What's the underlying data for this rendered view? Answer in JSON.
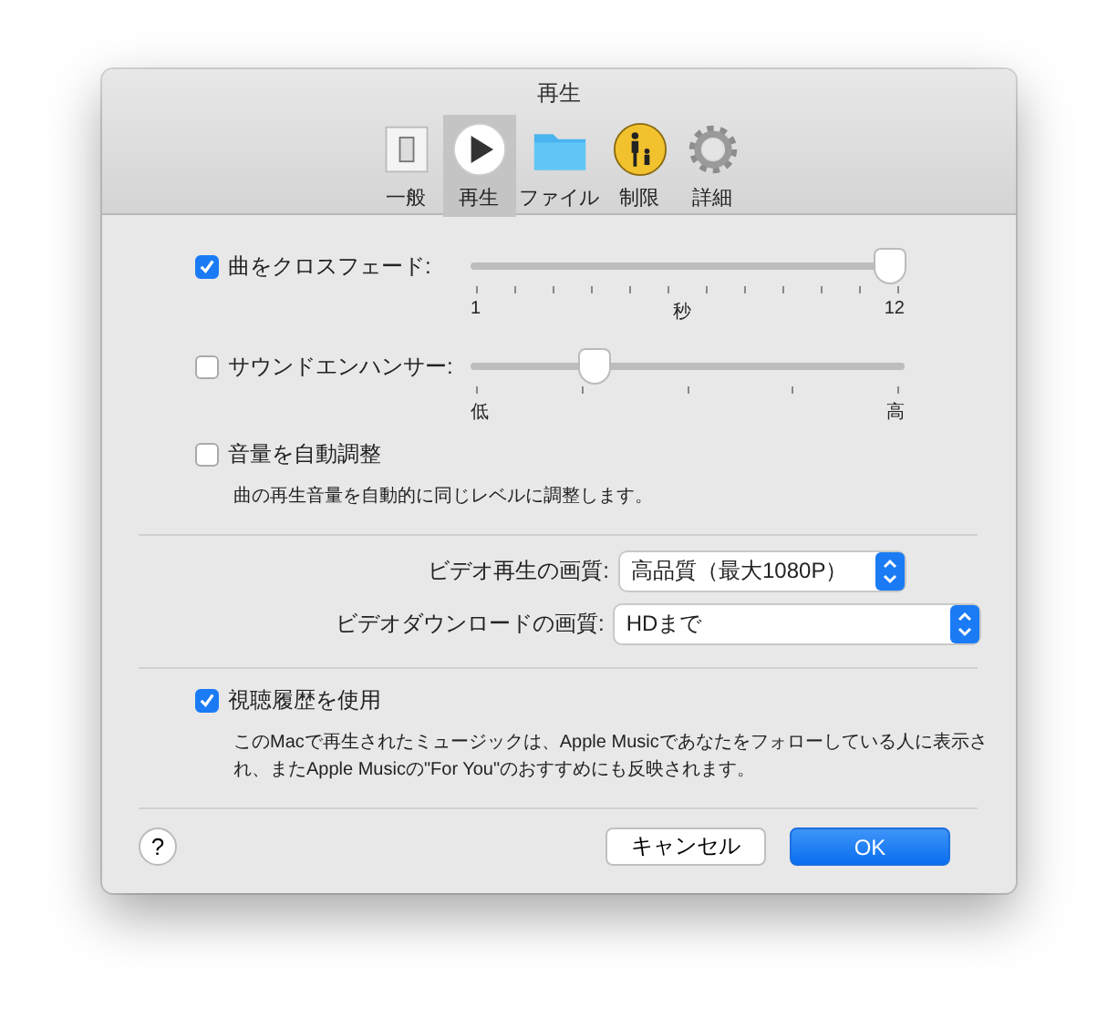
{
  "window": {
    "title": "再生"
  },
  "tabs": [
    {
      "label": "一般",
      "kind": "general",
      "selected": false
    },
    {
      "label": "再生",
      "kind": "playback",
      "selected": true
    },
    {
      "label": "ファイル",
      "kind": "files",
      "selected": false
    },
    {
      "label": "制限",
      "kind": "restrictions",
      "selected": false
    },
    {
      "label": "詳細",
      "kind": "advanced",
      "selected": false
    }
  ],
  "sliders": [
    {
      "label": "曲をクロスフェード:",
      "kind": "seconds",
      "checked": true,
      "level": 1.0,
      "scale": [
        "1",
        "秒",
        "12"
      ]
    },
    {
      "label": "サウンドエンハンサー:",
      "kind": "range",
      "checked": false,
      "level": 0.27,
      "scale": [
        "低",
        "高"
      ]
    }
  ],
  "sound_check": {
    "label": "音量を自動調整",
    "checked": false,
    "description": "曲の再生音量を自動的に同じレベルに調整します。"
  },
  "popups": [
    {
      "label": "ビデオ再生の画質:",
      "value": "高品質（最大1080P）"
    },
    {
      "label": "ビデオダウンロードの画質:",
      "value": "HDまで"
    }
  ],
  "history": {
    "label": "視聴履歴を使用",
    "checked": true,
    "description": "このMacで再生されたミュージックは、Apple Musicであなたをフォローしている人に表示され、またApple Musicの\"For You\"のおすすめにも反映されます。"
  },
  "help": "?",
  "buttons": [
    {
      "label": "キャンセル",
      "kind": "cancel"
    },
    {
      "label": "OK",
      "kind": "default"
    }
  ]
}
